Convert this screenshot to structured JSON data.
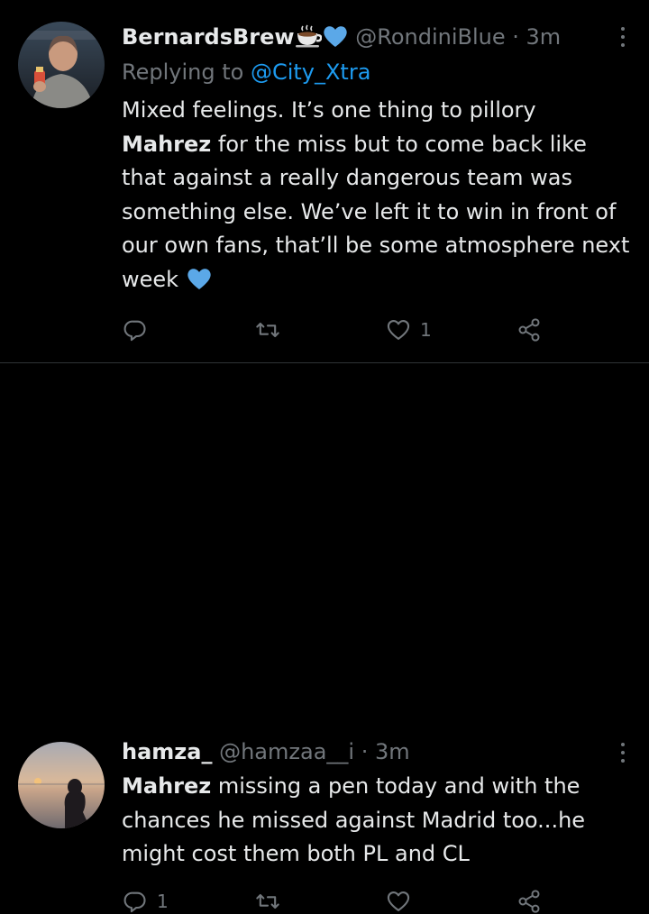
{
  "tweets": [
    {
      "name": "BernardsBrew",
      "emojis": [
        "hot-beverage",
        "blue-heart"
      ],
      "handle": "@RondiniBlue",
      "separator": "·",
      "time": "3m",
      "replying_prefix": "Replying to",
      "replying_handle": "@City_Xtra",
      "body_pre": "Mixed feelings. It’s one thing to pillory",
      "body_bold": "Mahrez",
      "body_post": " for the miss but to come back like that against a really dangerous team was something else. We’ve left it to win in front of our own fans, that’ll be some atmosphere next week",
      "body_emoji": "blue-heart",
      "actions": {
        "reply_count": "",
        "retweet_count": "",
        "like_count": "1"
      }
    },
    {
      "name": "hamza_",
      "handle": "@hamzaa__i",
      "separator": "·",
      "time": "3m",
      "body_bold": "Mahrez",
      "body_post": " missing a pen today and with the chances he missed against Madrid too...he might cost them both PL and CL",
      "actions": {
        "reply_count": "1",
        "retweet_count": "",
        "like_count": ""
      }
    }
  ],
  "colors": {
    "background": "#000000",
    "text_primary": "#e7e9ea",
    "text_secondary": "#71767b",
    "link": "#1d9bf0",
    "heart_emoji": "#5ba8e8",
    "divider": "#2f3336"
  },
  "icons": [
    "reply-icon",
    "retweet-icon",
    "like-icon",
    "share-icon",
    "more-icon"
  ]
}
